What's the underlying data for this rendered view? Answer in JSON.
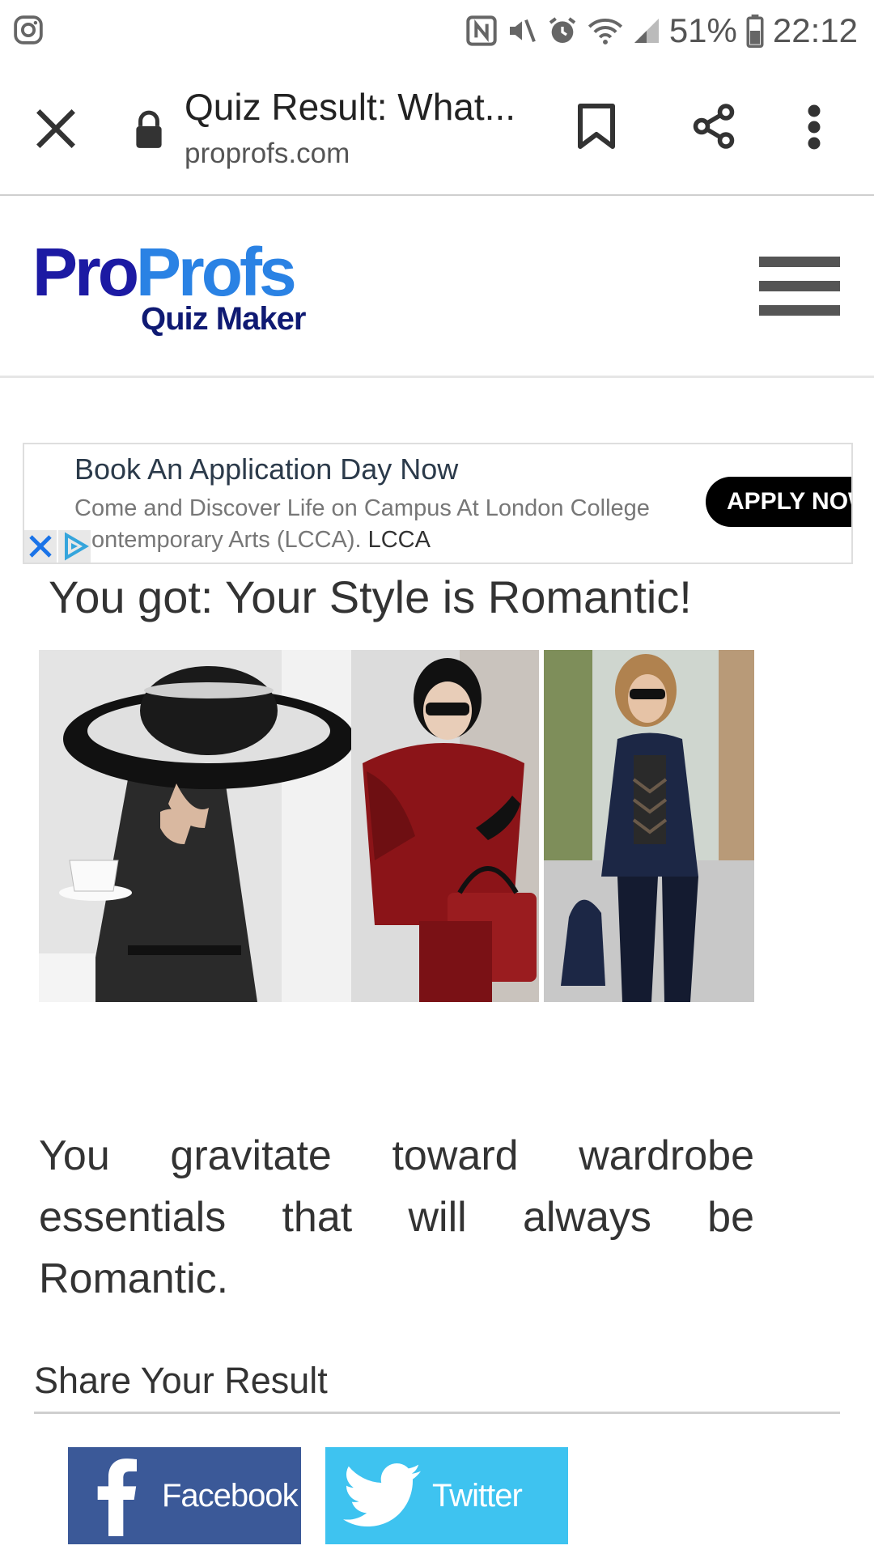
{
  "status_bar": {
    "left_icon": "instagram-icon",
    "icons": [
      "nfc-icon",
      "mute-icon",
      "alarm-icon",
      "wifi-icon",
      "signal-icon"
    ],
    "battery_percent": "51%",
    "time": "22:12"
  },
  "tab_bar": {
    "title": "Quiz Result: What...",
    "domain": "proprofs.com",
    "icons": [
      "close-icon",
      "lock-icon",
      "bookmark-icon",
      "share-icon",
      "more-vert-icon"
    ]
  },
  "site_header": {
    "logo_pro": "Pro",
    "logo_profs": "Profs",
    "logo_sub": "Quiz Maker",
    "menu_icon": "hamburger-menu-icon"
  },
  "ad": {
    "title": "Book An Application Day Now",
    "body": "Come and Discover Life on Campus At London College Contemporary Arts (LCCA).",
    "advertiser": "LCCA",
    "cta": "APPLY NOW"
  },
  "result": {
    "title": "You got: Your Style is Romantic!",
    "description": "You gravitate toward wardrobe essentials that will always be Romantic."
  },
  "share": {
    "heading": "Share Your Result",
    "facebook_label": "Facebook",
    "twitter_label": "Twitter"
  },
  "colors": {
    "facebook": "#3b5998",
    "twitter": "#3ec3f0",
    "logo_dark_blue": "#1c1aa3",
    "logo_light_blue": "#2a82e4"
  }
}
